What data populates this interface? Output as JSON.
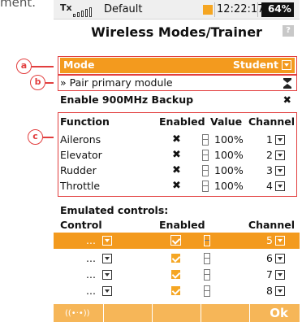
{
  "fragment_text": "ment.",
  "status": {
    "tx": "Tx",
    "model": "Default",
    "time": "12:22:17",
    "battery": "64%"
  },
  "title": "Wireless Modes/Trainer",
  "help_label": "?",
  "mode": {
    "label": "Mode",
    "value": "Student"
  },
  "pair": {
    "label": "» Pair primary module"
  },
  "backup": {
    "label": "Enable 900MHz Backup",
    "value": "✖"
  },
  "functions": {
    "headers": [
      "Function",
      "Enabled",
      "Value",
      "Channel"
    ],
    "rows": [
      {
        "name": "Ailerons",
        "enabled": "✖",
        "value": "100%",
        "channel": "1"
      },
      {
        "name": "Elevator",
        "enabled": "✖",
        "value": "100%",
        "channel": "2"
      },
      {
        "name": "Rudder",
        "enabled": "✖",
        "value": "100%",
        "channel": "3"
      },
      {
        "name": "Throttle",
        "enabled": "✖",
        "value": "100%",
        "channel": "4"
      }
    ]
  },
  "emulated": {
    "heading": "Emulated controls:",
    "headers": [
      "Control",
      "Enabled",
      "Channel"
    ],
    "rows": [
      {
        "control": "...",
        "channel": "5"
      },
      {
        "control": "...",
        "channel": "6"
      },
      {
        "control": "...",
        "channel": "7"
      },
      {
        "control": "...",
        "channel": "8"
      }
    ]
  },
  "bottom": {
    "ok": "Ok"
  },
  "annotations": {
    "a": "a",
    "b": "b",
    "c": "c"
  },
  "colors": {
    "accent": "#f39a1e",
    "annotation": "#e23e3e"
  }
}
